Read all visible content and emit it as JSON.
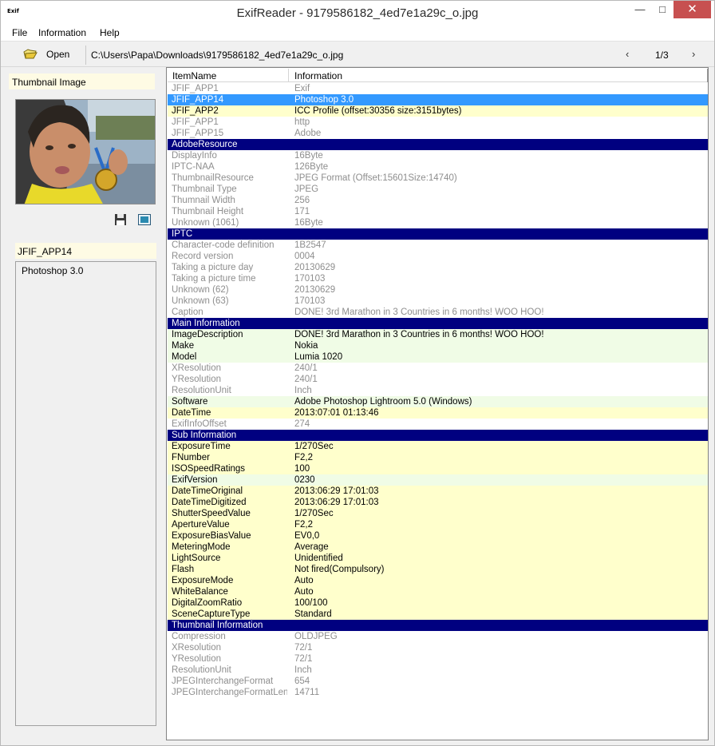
{
  "window": {
    "title": "ExifReader - 9179586182_4ed7e1a29c_o.jpg",
    "icon_text": "Exif",
    "min_glyph": "—",
    "max_glyph": "□",
    "close_glyph": "✕"
  },
  "menu": {
    "file": "File",
    "information": "Information",
    "help": "Help"
  },
  "toolbar": {
    "open_label": "Open",
    "path": "C:\\Users\\Papa\\Downloads\\9179586182_4ed7e1a29c_o.jpg",
    "prev_glyph": "‹",
    "next_glyph": "›",
    "page": "1/3"
  },
  "left": {
    "thumbnail_label": "Thumbnail Image",
    "selected_item_name": "JFIF_APP14",
    "selected_item_value": "Photoshop 3.0"
  },
  "colors": {
    "section": "#000080",
    "selected": "#3399ff",
    "yellow": "#ffffcc",
    "green": "#f0fce6",
    "gray_text": "#8e8e8e"
  },
  "list": {
    "col_item": "ItemName",
    "col_info": "Information",
    "rows": [
      {
        "type": "gray",
        "name": "JFIF_APP1",
        "value": "Exif"
      },
      {
        "type": "selected",
        "name": "JFIF_APP14",
        "value": "Photoshop 3.0"
      },
      {
        "type": "yellow",
        "name": "JFIF_APP2",
        "value": "ICC Profile (offset:30356 size:3151bytes)"
      },
      {
        "type": "gray",
        "name": "JFIF_APP1",
        "value": "http"
      },
      {
        "type": "gray",
        "name": "JFIF_APP15",
        "value": "Adobe"
      },
      {
        "type": "section",
        "name": "AdobeResource",
        "value": ""
      },
      {
        "type": "gray",
        "name": "DisplayInfo",
        "value": "16Byte"
      },
      {
        "type": "gray",
        "name": "IPTC-NAA",
        "value": "126Byte"
      },
      {
        "type": "gray",
        "name": "ThumbnailResource",
        "value": "JPEG Format (Offset:15601Size:14740)"
      },
      {
        "type": "gray",
        "name": "Thumbnail Type",
        "value": "JPEG"
      },
      {
        "type": "gray",
        "name": "Thumnail Width",
        "value": "256"
      },
      {
        "type": "gray",
        "name": "Thumbnail Height",
        "value": "171"
      },
      {
        "type": "gray",
        "name": "Unknown (1061)",
        "value": "16Byte"
      },
      {
        "type": "section",
        "name": "IPTC",
        "value": ""
      },
      {
        "type": "gray",
        "name": "Character-code definition",
        "value": "1B2547"
      },
      {
        "type": "gray",
        "name": "Record version",
        "value": "0004"
      },
      {
        "type": "gray",
        "name": "Taking a picture day",
        "value": "20130629"
      },
      {
        "type": "gray",
        "name": "Taking a picture time",
        "value": "170103"
      },
      {
        "type": "gray",
        "name": "Unknown (62)",
        "value": "20130629"
      },
      {
        "type": "gray",
        "name": "Unknown (63)",
        "value": "170103"
      },
      {
        "type": "gray",
        "name": "Caption",
        "value": "DONE!  3rd Marathon in 3 Countries in 6 months!  WOO HOO!"
      },
      {
        "type": "section",
        "name": "Main Information",
        "value": ""
      },
      {
        "type": "green",
        "name": "ImageDescription",
        "value": "DONE!  3rd Marathon in 3 Countries in 6 months!  WOO HOO!"
      },
      {
        "type": "green",
        "name": "Make",
        "value": "Nokia"
      },
      {
        "type": "green",
        "name": "Model",
        "value": "Lumia 1020"
      },
      {
        "type": "gray",
        "name": "XResolution",
        "value": "240/1"
      },
      {
        "type": "gray",
        "name": "YResolution",
        "value": "240/1"
      },
      {
        "type": "gray",
        "name": "ResolutionUnit",
        "value": "Inch"
      },
      {
        "type": "green",
        "name": "Software",
        "value": "Adobe Photoshop Lightroom 5.0 (Windows)"
      },
      {
        "type": "yellow",
        "name": "DateTime",
        "value": "2013:07:01 01:13:46"
      },
      {
        "type": "gray",
        "name": "ExifInfoOffset",
        "value": "274"
      },
      {
        "type": "section",
        "name": "Sub Information",
        "value": ""
      },
      {
        "type": "yellow",
        "name": "ExposureTime",
        "value": "1/270Sec"
      },
      {
        "type": "yellow",
        "name": "FNumber",
        "value": "F2,2"
      },
      {
        "type": "yellow",
        "name": "ISOSpeedRatings",
        "value": "100"
      },
      {
        "type": "green",
        "name": "ExifVersion",
        "value": "0230"
      },
      {
        "type": "yellow",
        "name": "DateTimeOriginal",
        "value": "2013:06:29 17:01:03"
      },
      {
        "type": "yellow",
        "name": "DateTimeDigitized",
        "value": "2013:06:29 17:01:03"
      },
      {
        "type": "yellow",
        "name": "ShutterSpeedValue",
        "value": "1/270Sec"
      },
      {
        "type": "yellow",
        "name": "ApertureValue",
        "value": "F2,2"
      },
      {
        "type": "yellow",
        "name": "ExposureBiasValue",
        "value": "EV0,0"
      },
      {
        "type": "yellow",
        "name": "MeteringMode",
        "value": "Average"
      },
      {
        "type": "yellow",
        "name": "LightSource",
        "value": "Unidentified"
      },
      {
        "type": "yellow",
        "name": "Flash",
        "value": "Not fired(Compulsory)"
      },
      {
        "type": "yellow",
        "name": "ExposureMode",
        "value": "Auto"
      },
      {
        "type": "yellow",
        "name": "WhiteBalance",
        "value": "Auto"
      },
      {
        "type": "yellow",
        "name": "DigitalZoomRatio",
        "value": "100/100"
      },
      {
        "type": "yellow",
        "name": "SceneCaptureType",
        "value": "Standard"
      },
      {
        "type": "section",
        "name": "Thumbnail Information",
        "value": ""
      },
      {
        "type": "gray",
        "name": "Compression",
        "value": "OLDJPEG"
      },
      {
        "type": "gray",
        "name": "XResolution",
        "value": "72/1"
      },
      {
        "type": "gray",
        "name": "YResolution",
        "value": "72/1"
      },
      {
        "type": "gray",
        "name": "ResolutionUnit",
        "value": "Inch"
      },
      {
        "type": "gray",
        "name": "JPEGInterchangeFormat",
        "value": "654"
      },
      {
        "type": "gray",
        "name": "JPEGInterchangeFormatLen...",
        "value": "14711"
      }
    ]
  }
}
